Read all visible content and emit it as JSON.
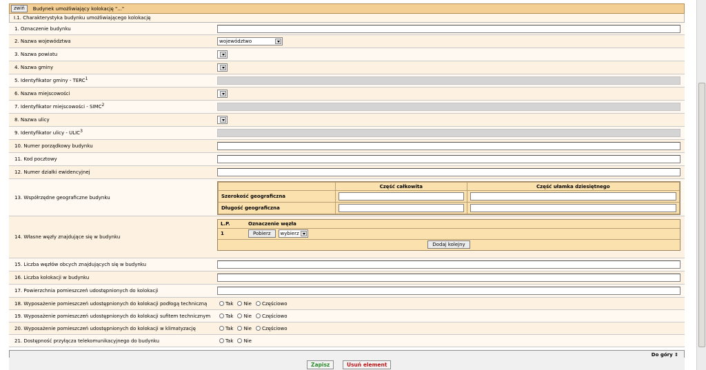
{
  "header": {
    "toggle_label": "zwiń",
    "title": "Budynek umożliwiający kolokację \"...\""
  },
  "section_title": "I.1. Charakterystyka budynku umożliwiającego kolokację",
  "rows": {
    "r1": "1. Oznaczenie budynku",
    "r2": "2. Nazwa województwa",
    "r2_select": "województwo",
    "r3": "3. Nazwa powiatu",
    "r4": "4. Nazwa gminy",
    "r5": "5. Identyfikator gminy - TERC",
    "r5_sup": "1",
    "r6": "6. Nazwa miejscowości",
    "r7": "7. Identyfikator miejscowości - SIMC",
    "r7_sup": "2",
    "r8": "8. Nazwa ulicy",
    "r9": "9. Identyfikator ulicy - ULIC",
    "r9_sup": "3",
    "r10": "10. Numer porządkowy budynku",
    "r11": "11. Kod pocztowy",
    "r12": "12. Numer działki ewidencyjnej",
    "r13": "13. Współrzędne geograficzne budynku",
    "r14": "14. Własne węzły znajdujące się w budynku",
    "r15": "15. Liczba węzłów obcych znajdujących się w budynku",
    "r16": "16. Liczba kolokacji w budynku",
    "r17": "17. Powierzchnia pomieszczeń udostępnionych do kolokacji",
    "r18": "18. Wyposażenie pomieszczeń udostępnionych do kolokacji podłogą techniczną",
    "r19": "19. Wyposażenie pomieszczeń udostępnionych do kolokacji sufitem technicznym",
    "r20": "20. Wyposażenie pomieszczeń udostępnionych do kolokacji w klimatyzację",
    "r21": "21. Dostępność przyłącza telekomunikacyjnego do budynku"
  },
  "coords": {
    "col_whole": "Część całkowita",
    "col_decimal": "Część ułamka dziesiętnego",
    "lat": "Szerokość geograficzna",
    "lon": "Długość geograficzna"
  },
  "nodes": {
    "col_lp": "L.P.",
    "col_name": "Oznaczenie węzła",
    "row_lp": "1",
    "fetch_btn": "Pobierz",
    "select_value": "wybierz",
    "add_btn": "Dodaj kolejny"
  },
  "radio": {
    "yes": "Tak",
    "no": "Nie",
    "partial": "Częściowo"
  },
  "footer": {
    "top_link": "Do góry"
  },
  "actions": {
    "save": "Zapisz",
    "delete": "Usuń element"
  }
}
